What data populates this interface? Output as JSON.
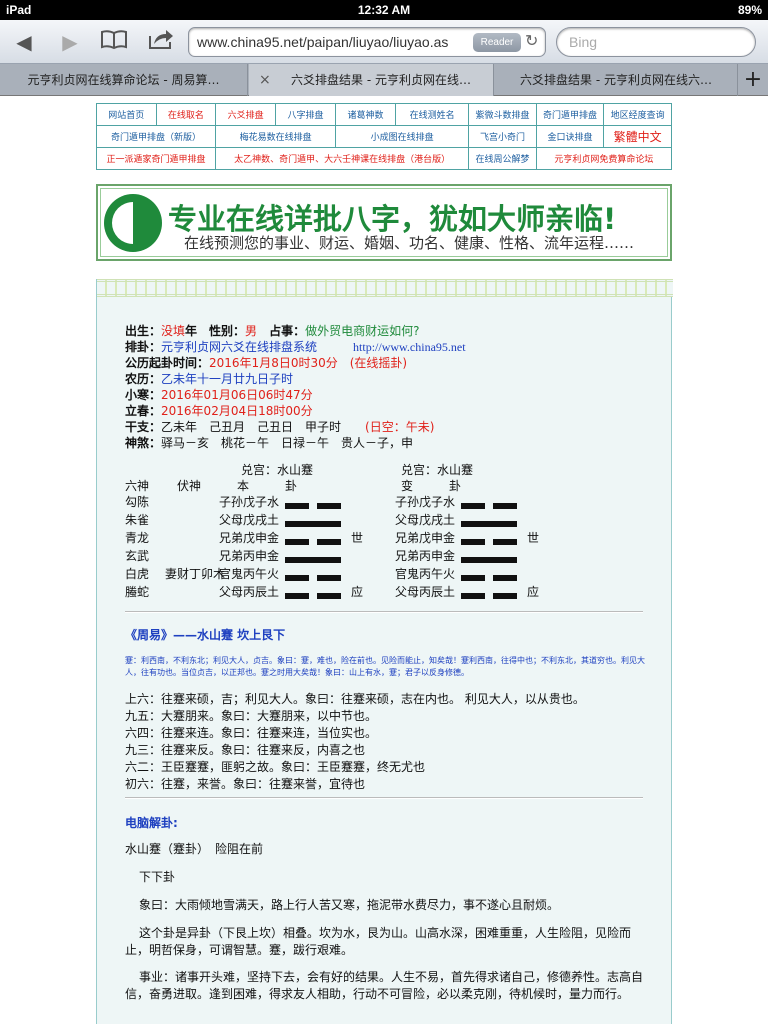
{
  "status": {
    "device": "iPad",
    "time": "12:32 AM",
    "battery": "89%"
  },
  "browser": {
    "url": "www.china95.net/paipan/liuyao/liuyao.as",
    "reader": "Reader",
    "search_placeholder": "Bing",
    "tabs": [
      "元亨利贞网在线算命论坛 - 周易算…",
      "六爻排盘结果 - 元亨利贞网在线…",
      "六爻排盘结果 - 元亨利贞网在线六…"
    ]
  },
  "nav": [
    [
      "网站首页",
      "在线取名",
      "六爻排盘",
      "八字排盘",
      "诸葛神数",
      "在线测姓名",
      "紫微斗数排盘",
      "奇门遁甲排盘",
      "地区经度查询"
    ],
    [
      "奇门遁甲排盘（新版）",
      "梅花易数在线排盘",
      "小成图在线排盘",
      "飞宫小奇门",
      "金口诀排盘",
      "繁體中文"
    ],
    [
      "正一派遁家奇门遁甲排盘",
      "太乙神数、奇门遁甲、大六壬神课在线排盘（港台版）",
      "在线周公解梦",
      "元亨利贞网免费算命论坛"
    ]
  ],
  "banner": {
    "title": "专业在线详批八字，犹如大师亲临!",
    "subtitle": "在线预测您的事业、财运、婚姻、功名、健康、性格、流年运程……"
  },
  "info": {
    "l1": {
      "k1": "出生：",
      "v1": "没填",
      "k2": "年　性别：",
      "v2": "男",
      "k3": "　占事：",
      "v3": "做外贸电商财运如何?"
    },
    "l2": {
      "k": "排卦：",
      "v": "元亨利贞网六爻在线排盘系统",
      "url": "http://www.china95.net"
    },
    "l3": {
      "k": "公历起卦时间：",
      "v": "2016年1月8日0时30分",
      "extra": "(在线摇卦)"
    },
    "l4": {
      "k": "农历：",
      "v": "乙未年十一月廿九日子时"
    },
    "l5": {
      "k": "小寒：",
      "v": "2016年01月06日06时47分"
    },
    "l6": {
      "k": "立春：",
      "v": "2016年02月04日18时00分"
    },
    "l7": {
      "k": "干支：",
      "v": "乙未年　己丑月　己丑日　甲子时",
      "void": "(日空：午未)"
    },
    "l8": {
      "k": "神煞：",
      "v": "驿马－亥　桃花－午　日禄－午　贵人－子，申"
    }
  },
  "gua": {
    "palace_main": "兑宫：水山蹇",
    "palace_change": "兑宫：水山蹇",
    "headers": [
      "六神",
      "伏神",
      "本　　　卦",
      "变　　　卦"
    ],
    "rows": [
      {
        "god": "勾陈",
        "fu": "",
        "main": "子孙戊子水",
        "mline": "yin",
        "mark": "",
        "chg": "子孙戊子水",
        "cline": "yin",
        "cmark": ""
      },
      {
        "god": "朱雀",
        "fu": "",
        "main": "父母戊戌土",
        "mline": "yang",
        "mark": "",
        "chg": "父母戊戌土",
        "cline": "yang",
        "cmark": ""
      },
      {
        "god": "青龙",
        "fu": "",
        "main": "兄弟戊申金",
        "mline": "yin",
        "mark": "世",
        "chg": "兄弟戊申金",
        "cline": "yin",
        "cmark": "世"
      },
      {
        "god": "玄武",
        "fu": "",
        "main": "兄弟丙申金",
        "mline": "yang",
        "mark": "",
        "chg": "兄弟丙申金",
        "cline": "yang",
        "cmark": ""
      },
      {
        "god": "白虎",
        "fu": "妻财丁卯木",
        "main": "官鬼丙午火",
        "mline": "yin",
        "mark": "",
        "chg": "官鬼丙午火",
        "cline": "yin",
        "cmark": ""
      },
      {
        "god": "螣蛇",
        "fu": "",
        "main": "父母丙辰土",
        "mline": "yin",
        "mark": "应",
        "chg": "父母丙辰土",
        "cline": "yin",
        "cmark": "应"
      }
    ]
  },
  "zhouyi": {
    "title": "《周易》——水山蹇 坎上艮下",
    "text": "蹇：利西南，不利东北；利见大人，贞吉。象曰：蹇，难也，险在前也。见险而能止，知矣哉！蹇利西南，往得中也；不利东北，其道穷也。利见大人，往有功也。当位贞吉，以正邦也。蹇之时用大矣哉！象曰：山上有水，蹇；君子以反身修德。",
    "yao": [
      "上六：往蹇来硕，吉；利见大人。象曰：往蹇来硕，志在内也。 利见大人，以从贵也。",
      "九五：大蹇朋来。象曰：大蹇朋来，以中节也。",
      "六四：往蹇来连。象曰：往蹇来连，当位实也。",
      "九三：往蹇来反。象曰：往蹇来反，内喜之也",
      "六二：王臣蹇蹇，匪躬之故。象曰：王臣蹇蹇，终无尤也",
      "初六：往蹇，来誉。象曰：往蹇来誉，宜待也"
    ]
  },
  "pc": {
    "title": "电脑解卦:",
    "l1": "水山蹇（蹇卦）　险阻在前",
    "l2": "下下卦",
    "p1": "象曰：大雨倾地雪满天，路上行人苦又寒，拖泥带水费尽力，事不遂心且耐烦。",
    "p2": "这个卦是异卦（下艮上坎）相叠。坎为水，艮为山。山高水深，困难重重，人生险阻，见险而止，明哲保身，可谓智慧。蹇，跋行艰难。",
    "p3": "事业：诸事开头难，坚持下去，会有好的结果。人生不易，首先得求诸自己，修德养性。志高自信，奋勇进取。逢到困难，得求友人相助，行动不可冒险，必以柔克刚，待机候时，量力而行。"
  }
}
